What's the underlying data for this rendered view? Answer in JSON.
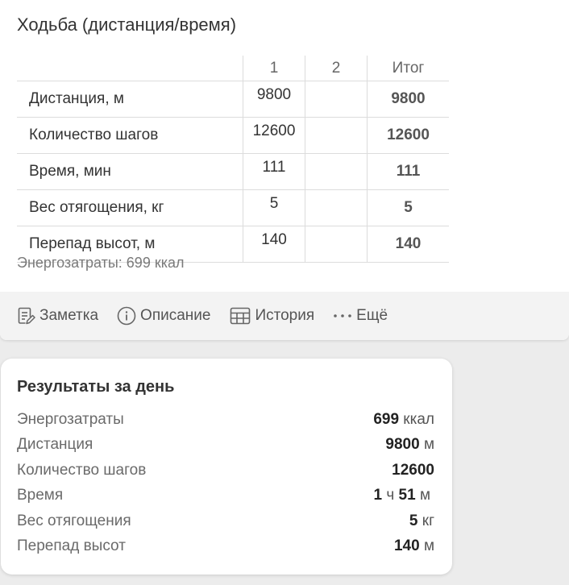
{
  "exercise": {
    "title": "Ходьба (дистанция/время)",
    "table": {
      "headers": [
        "",
        "1",
        "2",
        "Итог"
      ],
      "rows": [
        {
          "label": "Дистанция, м",
          "set1": "9800",
          "set2": "",
          "total": "9800"
        },
        {
          "label": "Количество шагов",
          "set1": "12600",
          "set2": "",
          "total": "12600"
        },
        {
          "label": "Время, мин",
          "set1": "111",
          "set2": "",
          "total": "111"
        },
        {
          "label": "Вес отягощения, кг",
          "set1": "5",
          "set2": "",
          "total": "5"
        },
        {
          "label": "Перепад высот, м",
          "set1": "140",
          "set2": "",
          "total": "140"
        }
      ]
    },
    "energy_text": "Энергозатраты: 699 ккал"
  },
  "toolbar": {
    "note_label": "Заметка",
    "description_label": "Описание",
    "history_label": "История",
    "more_label": "Ещё"
  },
  "results": {
    "title": "Результаты за день",
    "energy": {
      "label": "Энергозатраты",
      "value": "699",
      "unit": "ккал"
    },
    "distance": {
      "label": "Дистанция",
      "value": "9800",
      "unit": "м"
    },
    "steps": {
      "label": "Количество шагов",
      "value": "12600"
    },
    "time": {
      "label": "Время",
      "hours": "1",
      "hours_unit": "ч",
      "minutes": "51",
      "minutes_unit": "м"
    },
    "weight": {
      "label": "Вес отягощения",
      "value": "5",
      "unit": "кг"
    },
    "elevation": {
      "label": "Перепад высот",
      "value": "140",
      "unit": "м"
    }
  },
  "colors": {
    "background": "#ececec",
    "card": "#ffffff",
    "toolbar": "#f3f3f3",
    "text": "#333333",
    "muted_text": "#7a7a7a",
    "icon": "#666666"
  }
}
